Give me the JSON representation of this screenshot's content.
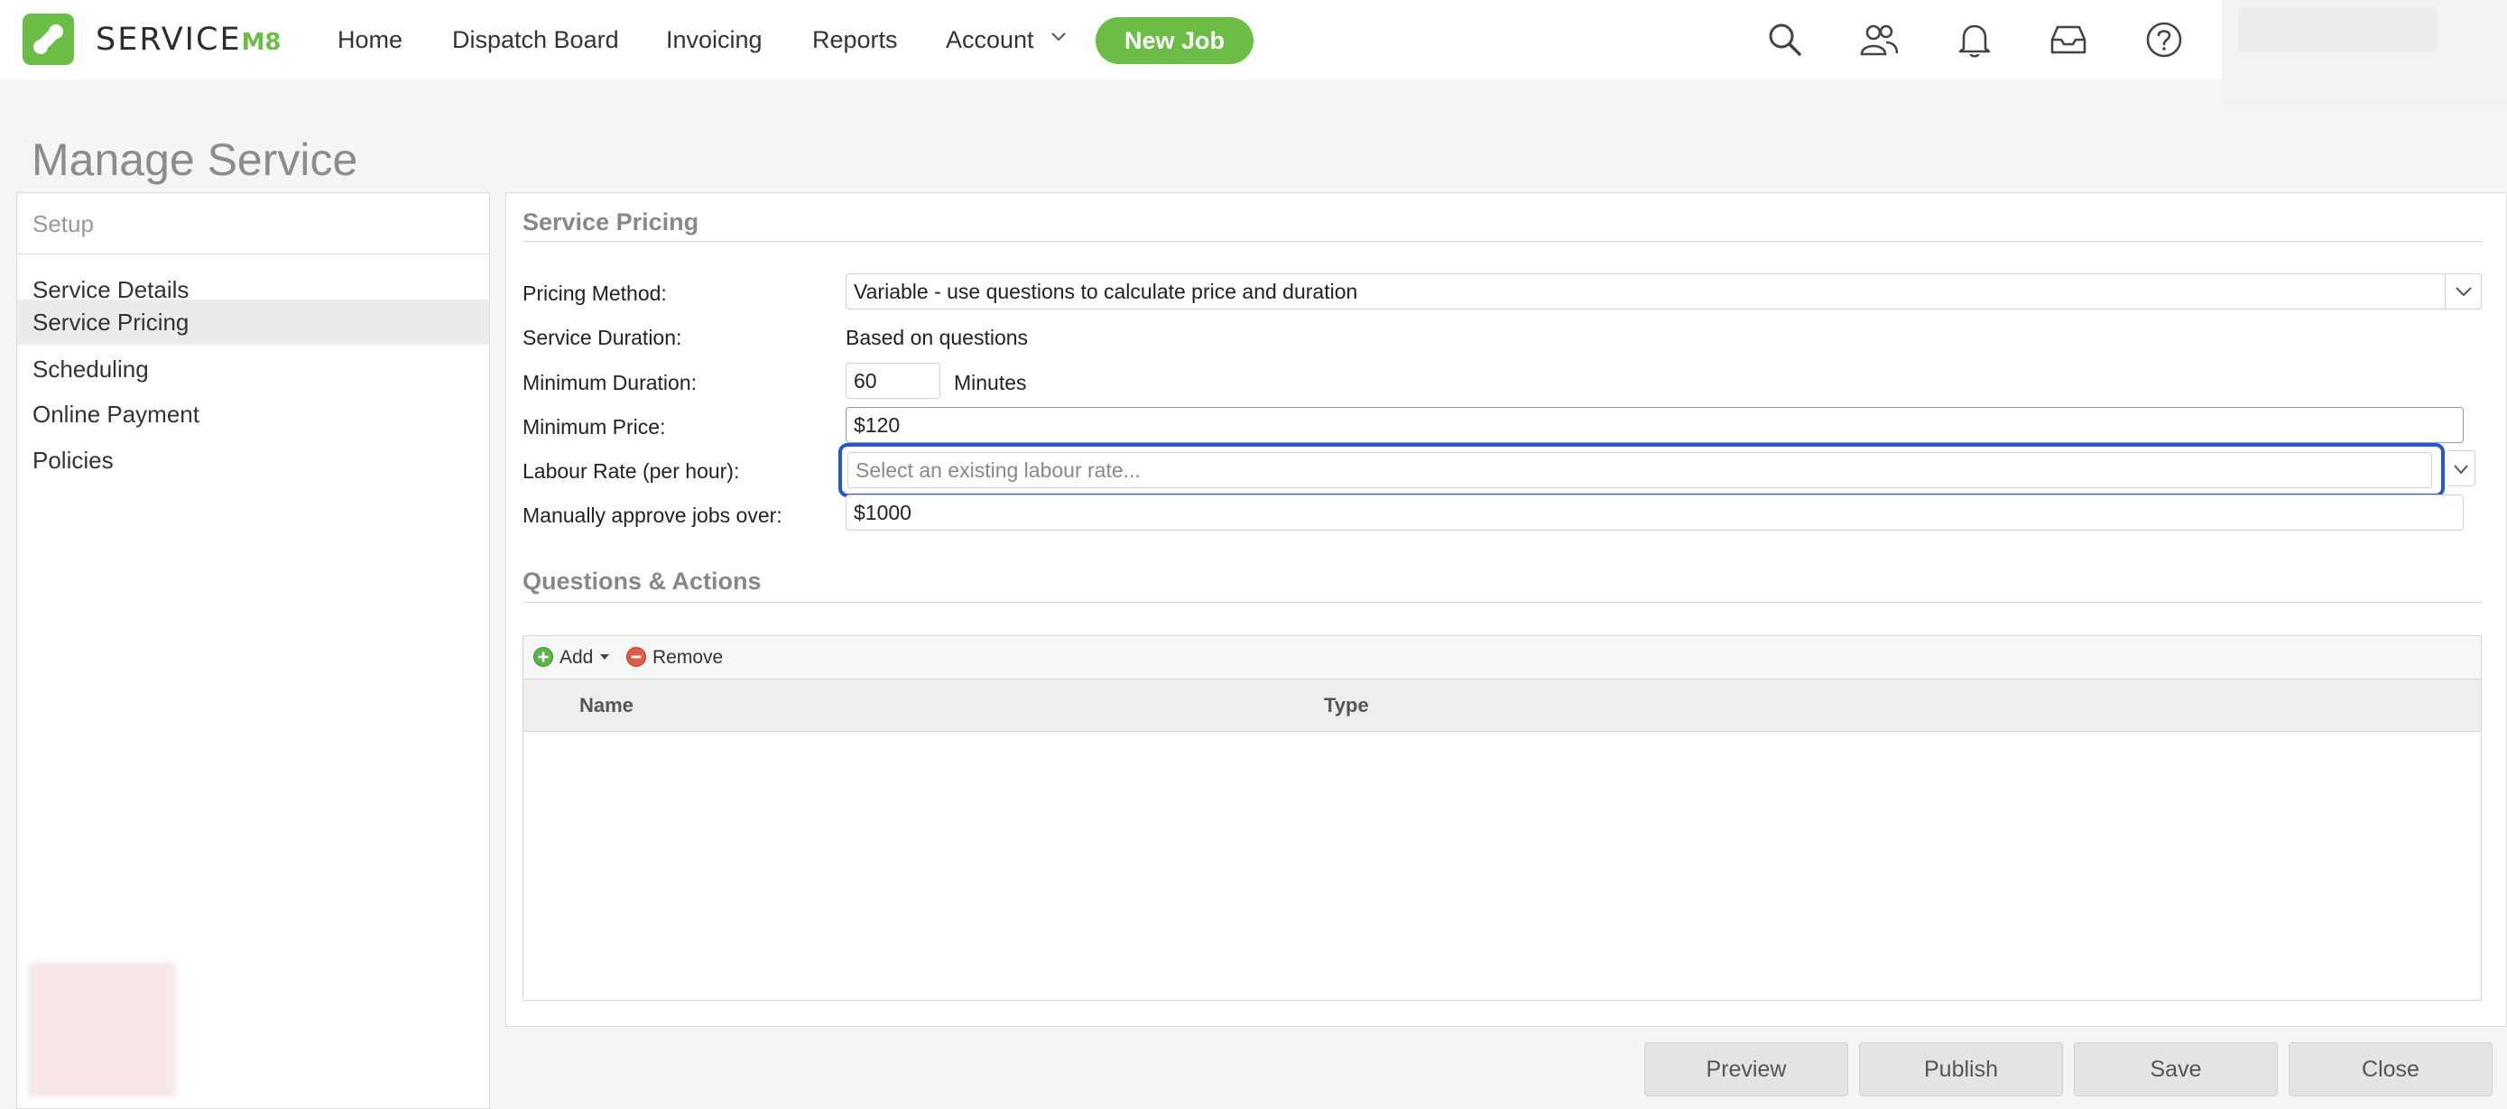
{
  "app": {
    "brand_word": "SERVICE",
    "brand_suffix": "M8",
    "colors": {
      "brand_green": "#6cbd45",
      "focus_blue": "#2456d8"
    }
  },
  "nav": {
    "home": "Home",
    "dispatch_board": "Dispatch Board",
    "invoicing": "Invoicing",
    "reports": "Reports",
    "account": "Account",
    "new_job": "New Job",
    "icons": [
      "search-icon",
      "people-icon",
      "bell-icon",
      "inbox-icon",
      "help-icon"
    ]
  },
  "page": {
    "title": "Manage Service"
  },
  "sidebar": {
    "header": "Setup",
    "items": [
      {
        "label": "Service Details",
        "active": false
      },
      {
        "label": "Service Pricing",
        "active": true
      },
      {
        "label": "Scheduling",
        "active": false
      },
      {
        "label": "Online Payment",
        "active": false
      },
      {
        "label": "Policies",
        "active": false
      }
    ]
  },
  "pricing": {
    "section_title": "Service Pricing",
    "pricing_method_label": "Pricing Method:",
    "pricing_method_value": "Variable - use questions to calculate price and duration",
    "service_duration_label": "Service Duration:",
    "service_duration_value": "Based on questions",
    "minimum_duration_label": "Minimum Duration:",
    "minimum_duration_value": "60",
    "minimum_duration_unit": "Minutes",
    "minimum_price_label": "Minimum Price:",
    "minimum_price_value": "$120",
    "labour_rate_label": "Labour Rate (per hour):",
    "labour_rate_placeholder": "Select an existing labour rate...",
    "approve_label": "Manually approve jobs over:",
    "approve_value": "$1000"
  },
  "questions": {
    "section_title": "Questions & Actions",
    "add_label": "Add",
    "remove_label": "Remove",
    "columns": [
      "Name",
      "Type"
    ]
  },
  "footer": {
    "preview": "Preview",
    "publish": "Publish",
    "save": "Save",
    "close": "Close"
  }
}
